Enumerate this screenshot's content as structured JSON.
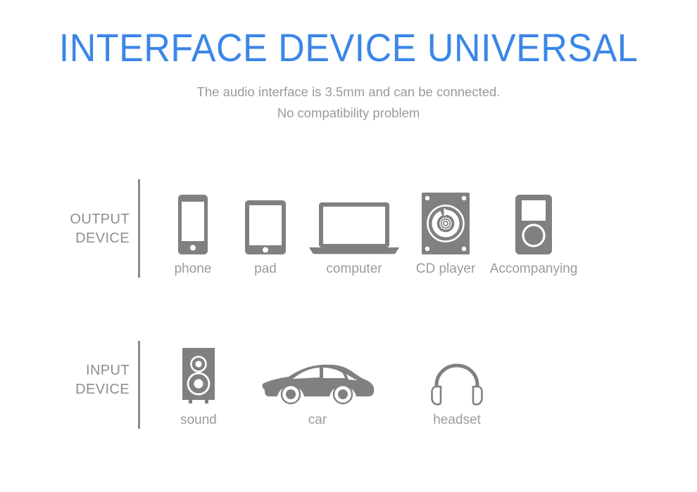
{
  "header": {
    "title": "INTERFACE DEVICE UNIVERSAL",
    "subtitle_line1": "The audio interface is 3.5mm and can be connected.",
    "subtitle_line2": "No compatibility problem"
  },
  "colors": {
    "title_blue": "#3b86e8",
    "icon_gray": "#808080",
    "text_gray": "#9b9b9b",
    "label_gray": "#8e8e8e",
    "divider_gray": "#8b8b8b",
    "background": "#ffffff"
  },
  "sections": [
    {
      "id": "output",
      "label_line1": "OUTPUT",
      "label_line2": "DEVICE",
      "items": [
        {
          "id": "phone",
          "caption": "phone",
          "icon": "smartphone-icon"
        },
        {
          "id": "pad",
          "caption": "pad",
          "icon": "tablet-icon"
        },
        {
          "id": "computer",
          "caption": "computer",
          "icon": "laptop-icon"
        },
        {
          "id": "cdplayer",
          "caption": "CD player",
          "icon": "cd-player-icon"
        },
        {
          "id": "accompany",
          "caption": "Accompanying",
          "icon": "mp3-player-icon"
        }
      ]
    },
    {
      "id": "input",
      "label_line1": "INPUT",
      "label_line2": "DEVICE",
      "items": [
        {
          "id": "sound",
          "caption": "sound",
          "icon": "speaker-icon"
        },
        {
          "id": "car",
          "caption": "car",
          "icon": "car-icon"
        },
        {
          "id": "headset",
          "caption": "headset",
          "icon": "headphones-icon"
        }
      ]
    }
  ]
}
